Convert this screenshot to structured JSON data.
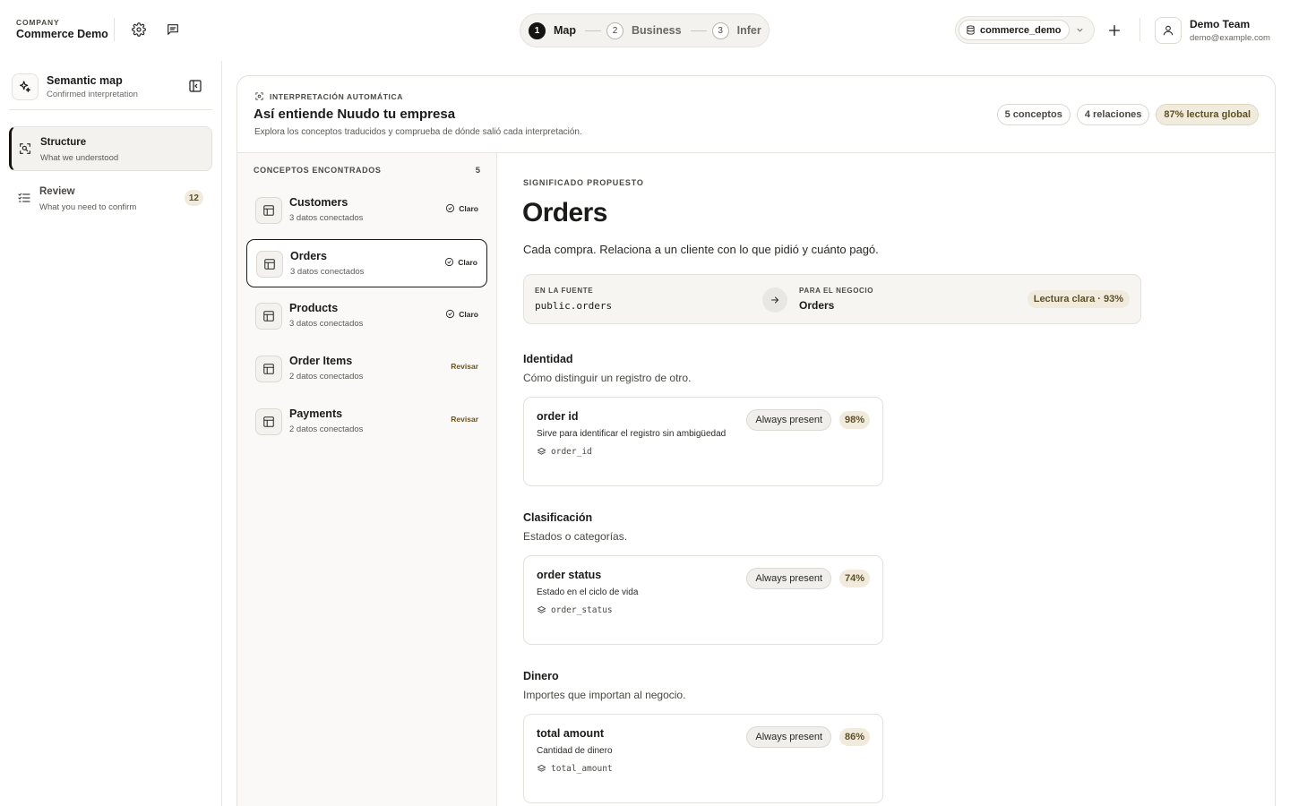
{
  "company": {
    "label": "COMPANY",
    "name": "Commerce Demo"
  },
  "stepper": [
    {
      "num": "1",
      "label": "Map"
    },
    {
      "num": "2",
      "label": "Business"
    },
    {
      "num": "3",
      "label": "Infer"
    }
  ],
  "database": {
    "name": "commerce_demo"
  },
  "user": {
    "name": "Demo Team",
    "email": "demo@example.com"
  },
  "sidebar": {
    "title": "Semantic map",
    "subtitle": "Confirmed interpretation",
    "items": [
      {
        "title": "Structure",
        "subtitle": "What we understood",
        "badge": ""
      },
      {
        "title": "Review",
        "subtitle": "What you need to confirm",
        "badge": "12"
      }
    ]
  },
  "header": {
    "eyebrow": "INTERPRETACIÓN AUTOMÁTICA",
    "title": "Así entiende Nuudo tu empresa",
    "description": "Explora los conceptos traducidos y comprueba de dónde salió cada interpretación.",
    "stats": [
      "5 conceptos",
      "4 relaciones",
      "87% lectura global"
    ]
  },
  "concepts": {
    "heading": "CONCEPTOS ENCONTRADOS",
    "count": "5",
    "items": [
      {
        "title": "Customers",
        "subtitle": "3 datos conectados",
        "status": "Claro"
      },
      {
        "title": "Orders",
        "subtitle": "3 datos conectados",
        "status": "Claro"
      },
      {
        "title": "Products",
        "subtitle": "3 datos conectados",
        "status": "Claro"
      },
      {
        "title": "Order Items",
        "subtitle": "2 datos conectados",
        "status": "Revisar"
      },
      {
        "title": "Payments",
        "subtitle": "2 datos conectados",
        "status": "Revisar"
      }
    ]
  },
  "detail": {
    "eyebrow": "SIGNIFICADO PROPUESTO",
    "title": "Orders",
    "description": "Cada compra. Relaciona a un cliente con lo que pidió y cuánto pagó.",
    "mapping": {
      "source_label": "EN LA FUENTE",
      "source_value": "public.orders",
      "business_label": "PARA EL NEGOCIO",
      "business_value": "Orders",
      "reading": "Lectura clara · 93%"
    },
    "sections": [
      {
        "title": "Identidad",
        "description": "Cómo distinguir un registro de otro.",
        "attr": {
          "name": "order id",
          "description": "Sirve para identificar el registro sin ambigüedad",
          "column": "order_id",
          "presence": "Always present",
          "score": "98%"
        }
      },
      {
        "title": "Clasificación",
        "description": "Estados o categorías.",
        "attr": {
          "name": "order status",
          "description": "Estado en el ciclo de vida",
          "column": "order_status",
          "presence": "Always present",
          "score": "74%"
        }
      },
      {
        "title": "Dinero",
        "description": "Importes que importan al negocio.",
        "attr": {
          "name": "total amount",
          "description": "Cantidad de dinero",
          "column": "total_amount",
          "presence": "Always present",
          "score": "86%"
        }
      }
    ]
  }
}
